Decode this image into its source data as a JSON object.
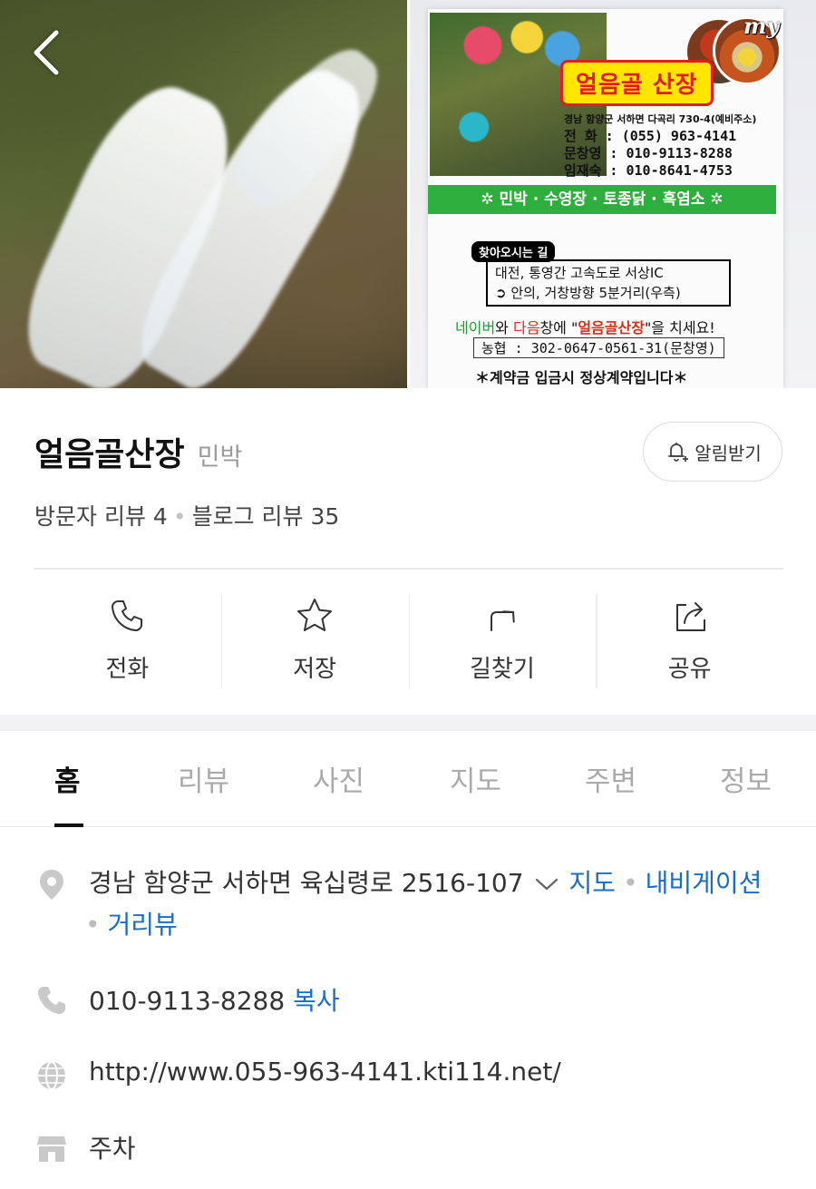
{
  "hero": {
    "my_label": "my",
    "poster": {
      "title": "얼음골 산장",
      "address": "경남 함양군 서하면 다곡리 730-4(예비주소)",
      "phone_line": "전  화 : (055) 963-4141",
      "contact1": "문창영 : 010-9113-8288",
      "contact2": "임재숙 : 010-8641-4753",
      "services": "✲ 민박 · 수영장 · 토종닭 · 흑염소 ✲",
      "way_tag": "찾아오시는 길",
      "way_line1": "대전, 통영간 고속도로 서상IC",
      "way_line2": "➲ 안의, 거창방향 5분거리(우측)",
      "search_part1": "네이버",
      "search_part2": "와 ",
      "search_part3": "다음",
      "search_part4": "창에 \"",
      "search_part5": "얼음골산장",
      "search_part6": "\"을 치세요!",
      "account": "농협 : 302-0647-0561-31(문창영)",
      "notice": "＊계약금 입금시 정상계약입니다＊"
    }
  },
  "place": {
    "name": "얼음골산장",
    "category": "민박",
    "notify_label": "알림받기",
    "visitor_reviews": "방문자 리뷰 4",
    "blog_reviews": "블로그 리뷰 35",
    "dot": "•"
  },
  "actions": [
    {
      "label": "전화",
      "icon": "phone-icon"
    },
    {
      "label": "저장",
      "icon": "star-icon"
    },
    {
      "label": "길찾기",
      "icon": "directions-icon"
    },
    {
      "label": "공유",
      "icon": "share-icon"
    }
  ],
  "tabs": [
    "홈",
    "리뷰",
    "사진",
    "지도",
    "주변",
    "정보"
  ],
  "active_tab": "홈",
  "info": {
    "address": "경남 함양군 서하면 육십령로 2516-107",
    "map_link": "지도",
    "navigation_link": "내비게이션",
    "roadview_link": "거리뷰",
    "phone": "010-9113-8288",
    "copy_label": "복사",
    "website": "http://www.055-963-4141.kti114.net/",
    "parking": "주차"
  },
  "colors": {
    "link": "#1b6cc4",
    "text": "#333333",
    "muted": "#9a9a9a"
  }
}
